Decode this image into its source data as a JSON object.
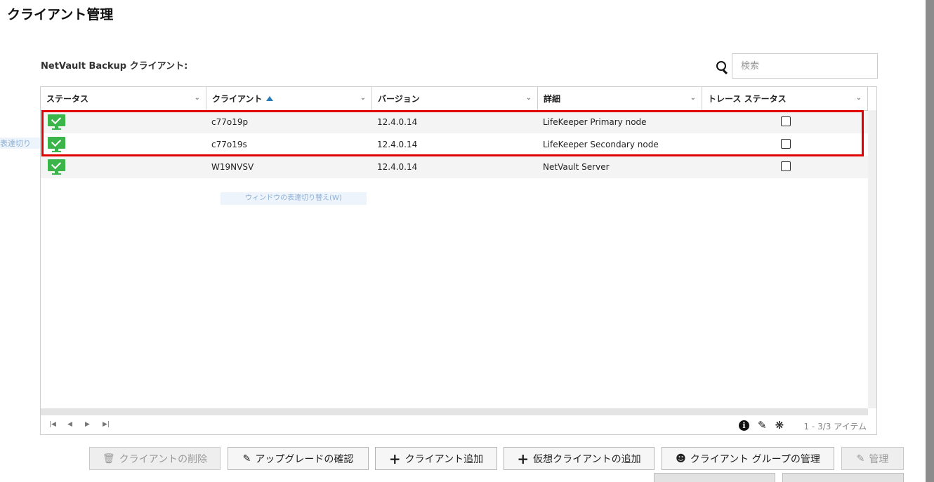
{
  "page": {
    "title": "クライアント管理"
  },
  "section": {
    "label": "NetVault Backup クライアント:"
  },
  "search": {
    "placeholder": "検索"
  },
  "table": {
    "columns": [
      "ステータス",
      "クライアント",
      "バージョン",
      "詳細",
      "トレース ステータス"
    ],
    "sorted_column": "クライアント",
    "sort_direction": "ascending",
    "rows": [
      {
        "status": "online",
        "client": "c77o19p",
        "version": "12.4.0.14",
        "detail": "LifeKeeper Primary node",
        "trace": false
      },
      {
        "status": "online",
        "client": "c77o19s",
        "version": "12.4.0.14",
        "detail": "LifeKeeper Secondary node",
        "trace": false
      },
      {
        "status": "online",
        "client": "W19NVSV",
        "version": "12.4.0.14",
        "detail": "NetVault Server",
        "trace": false
      }
    ],
    "item_count": "1 - 3/3 アイテム"
  },
  "ghost": {
    "left_text": "表達切り",
    "center_text": "ウィンドウの表達切り替え(W)"
  },
  "buttons": {
    "delete": "クライアントの削除",
    "upgrade": "アップグレードの確認",
    "add": "クライアント追加",
    "add_virtual": "仮想クライアントの追加",
    "groups": "クライアント グループの管理",
    "manage": "管理"
  },
  "colors": {
    "highlight": "#e00000",
    "status_online": "#3bb54a",
    "sort_arrow": "#2a7ab8"
  }
}
